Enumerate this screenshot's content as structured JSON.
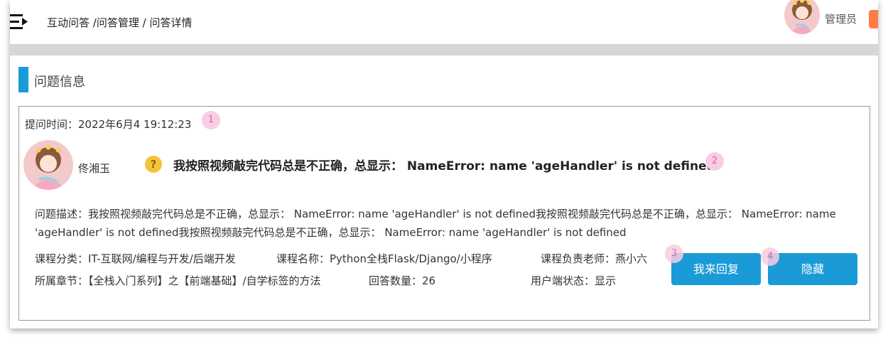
{
  "header": {
    "breadcrumb": {
      "part1": "互动问答",
      "sep1": " /",
      "part2": "问答管理",
      "sep2": " / ",
      "part3": "问答详情"
    },
    "admin_name": "管理员"
  },
  "section": {
    "title": "问题信息"
  },
  "question": {
    "ask_time": "提问时间：2022年6月4 19:12:23",
    "user_name": "佟湘玉",
    "question_icon": "?",
    "title": "我按照视频敲完代码总是不正确，总显示： NameError: name 'ageHandler' is not defined",
    "description": "问题描述：我按照视频敲完代码总是不正确，总显示： NameError: name 'ageHandler' is not defined我按照视频敲完代码总是不正确，总显示： NameError: name 'ageHandler' is not defined我按照视频敲完代码总是不正确，总显示： NameError: name 'ageHandler' is not defined"
  },
  "meta": {
    "category": "课程分类：IT-互联网/编程与开发/后端开发",
    "course_name": "课程名称：Python全栈Flask/Django/小程序",
    "teacher": "课程负责老师：燕小六",
    "chapter": "所属章节：【全栈入门系列】之【前端基础】/自学标签的方法",
    "answer_count": "回答数量：26",
    "user_status": "用户端状态：显示"
  },
  "actions": {
    "reply_label": "我来回复",
    "hide_label": "隐藏"
  },
  "badges": [
    "1",
    "2",
    "3",
    "4"
  ],
  "colors": {
    "accent": "#1a9ad6",
    "badge_bg": "#f9cde3",
    "admin_tab": "#ff7c45",
    "question_icon": "#f3c33c"
  },
  "icons": {
    "menu": "menu-toggle-icon",
    "question": "question-mark-icon"
  }
}
